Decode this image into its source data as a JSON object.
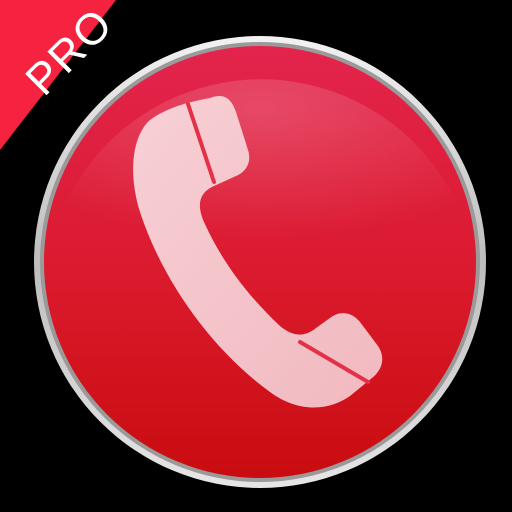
{
  "app": {
    "badge_label": "PRO"
  },
  "icons": {
    "main": "phone-handset-icon"
  },
  "colors": {
    "background": "#000000",
    "ribbon": "#f5233f",
    "button_top": "#e8254a",
    "button_bottom": "#c80d10",
    "bezel": "#d9d9d9",
    "handset": "#f4c6cb"
  }
}
